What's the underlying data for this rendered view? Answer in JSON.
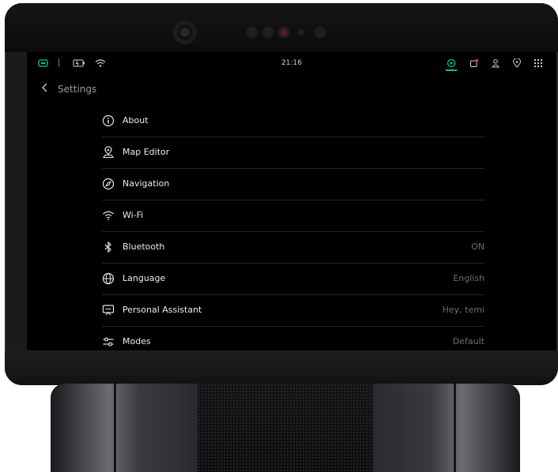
{
  "status_bar": {
    "time": "21:16",
    "accent_color": "#00c896",
    "left_icons": [
      "battery-icon",
      "charging-icon",
      "wifi-icon"
    ],
    "right_icons": [
      "navigation-target-icon",
      "notifications-icon",
      "user-icon",
      "location-pin-icon",
      "apps-grid-icon"
    ]
  },
  "header": {
    "back_icon": "chevron-left-icon",
    "title": "Settings"
  },
  "settings": {
    "items": [
      {
        "icon": "info-icon",
        "label": "About",
        "value": ""
      },
      {
        "icon": "map-editor-icon",
        "label": "Map Editor",
        "value": ""
      },
      {
        "icon": "compass-icon",
        "label": "Navigation",
        "value": ""
      },
      {
        "icon": "wifi-icon",
        "label": "Wi-Fi",
        "value": ""
      },
      {
        "icon": "bluetooth-icon",
        "label": "Bluetooth",
        "value": "ON"
      },
      {
        "icon": "globe-icon",
        "label": "Language",
        "value": "English"
      },
      {
        "icon": "assistant-icon",
        "label": "Personal Assistant",
        "value": "Hey, temi"
      },
      {
        "icon": "sliders-icon",
        "label": "Modes",
        "value": "Default"
      }
    ]
  }
}
